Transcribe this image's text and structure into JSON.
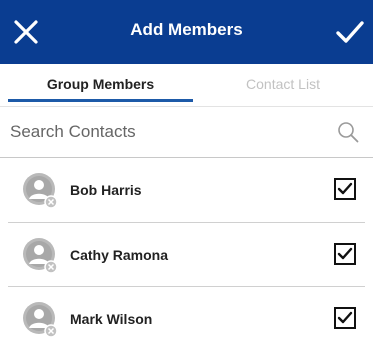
{
  "header": {
    "title": "Add Members",
    "close_icon": "close-icon",
    "confirm_icon": "check-icon",
    "background": "#0a3d91"
  },
  "tabs": [
    {
      "label": "Group Members",
      "active": true
    },
    {
      "label": "Contact List",
      "active": false
    }
  ],
  "search": {
    "placeholder": "Search Contacts",
    "value": "",
    "icon": "search-icon"
  },
  "members": [
    {
      "name": "Bob Harris",
      "checked": true,
      "avatar_icon": "person-avatar-icon"
    },
    {
      "name": "Cathy Ramona",
      "checked": true,
      "avatar_icon": "person-avatar-icon"
    },
    {
      "name": "Mark Wilson",
      "checked": true,
      "avatar_icon": "person-avatar-icon"
    }
  ],
  "colors": {
    "accent": "#1d5aa8",
    "header": "#0a3d91"
  }
}
